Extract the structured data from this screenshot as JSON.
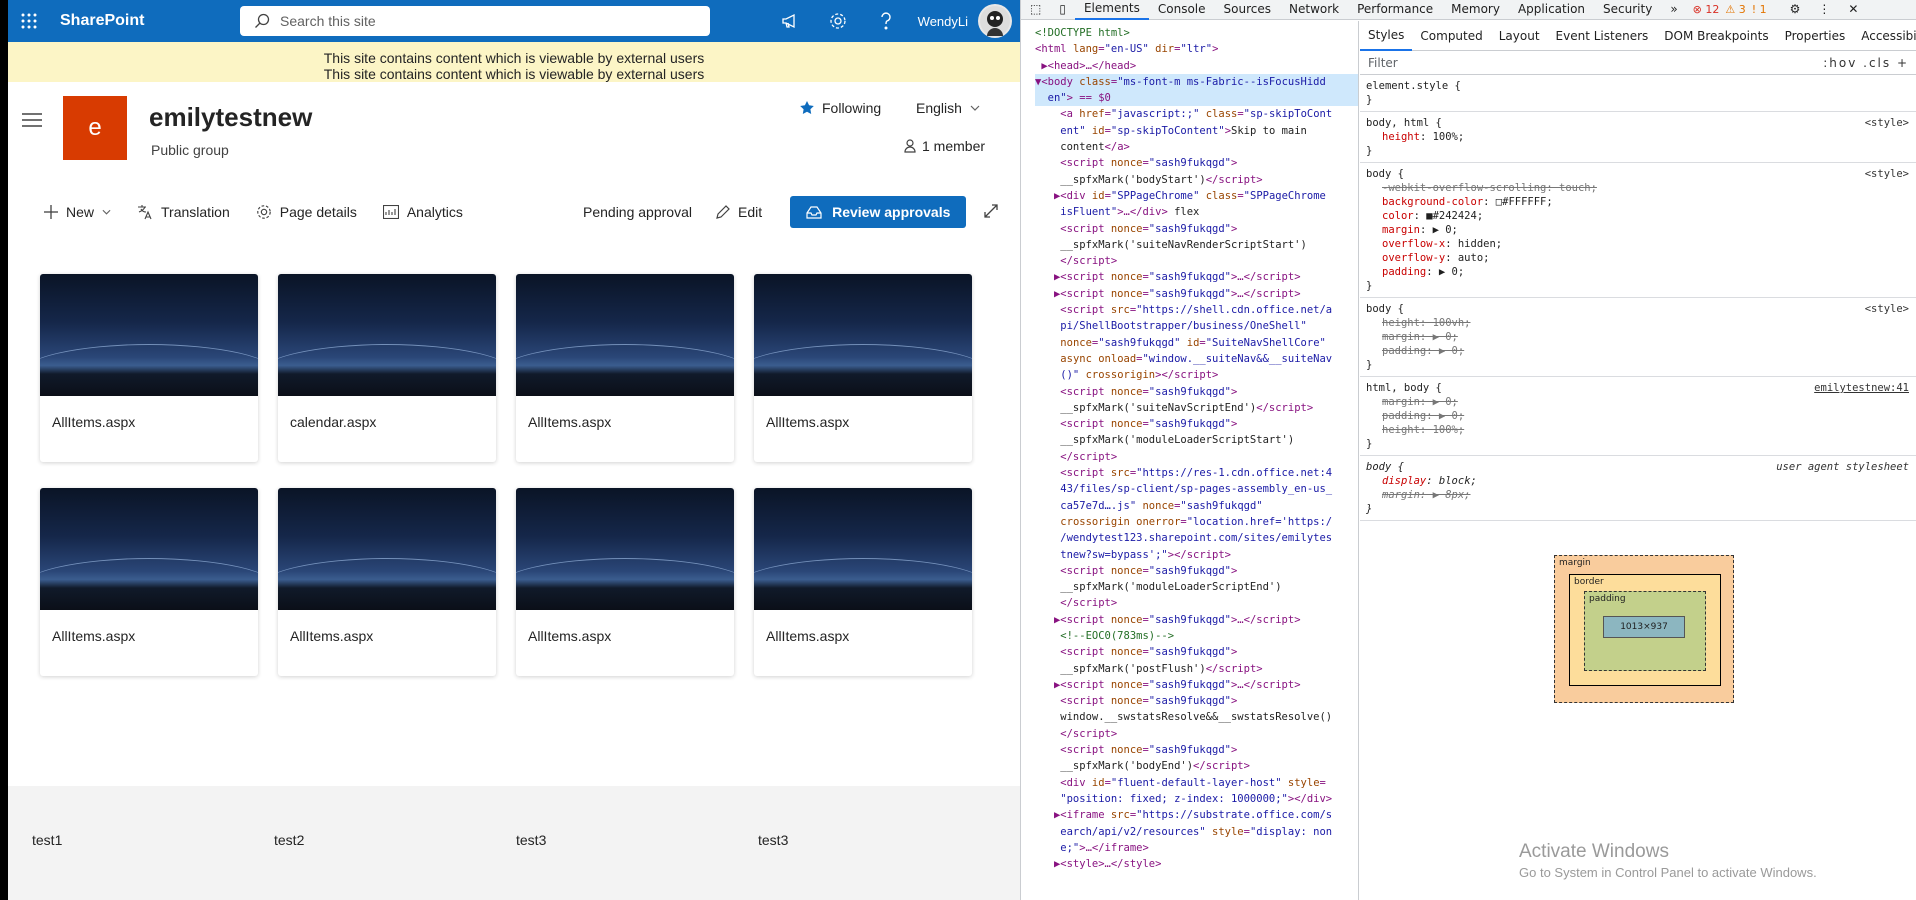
{
  "suite": {
    "brand": "SharePoint",
    "search_placeholder": "Search this site",
    "user": "WendyLi"
  },
  "banner": {
    "line1": "This site contains content which is viewable by external users",
    "line2": "This site contains content which is viewable by external users"
  },
  "site": {
    "logo_letter": "e",
    "title": "emilytestnew",
    "subtitle": "Public group",
    "following": "Following",
    "language": "English",
    "members": "1 member"
  },
  "commands": {
    "new": "New",
    "translation": "Translation",
    "page_details": "Page details",
    "analytics": "Analytics",
    "pending": "Pending approval",
    "edit": "Edit",
    "review": "Review approvals"
  },
  "cards": [
    "AllItems.aspx",
    "calendar.aspx",
    "AllItems.aspx",
    "AllItems.aspx",
    "AllItems.aspx",
    "AllItems.aspx",
    "AllItems.aspx",
    "AllItems.aspx"
  ],
  "footer": [
    "test1",
    "test2",
    "test3",
    "test3"
  ],
  "devtools": {
    "tabs": [
      "Elements",
      "Console",
      "Sources",
      "Network",
      "Performance",
      "Memory",
      "Application",
      "Security"
    ],
    "errors": "12",
    "warnings": "3",
    "issues": "1",
    "style_tabs": [
      "Styles",
      "Computed",
      "Layout",
      "Event Listeners",
      "DOM Breakpoints",
      "Properties",
      "Accessibility"
    ],
    "filter": "Filter",
    "filter_tools": ":hov .cls +",
    "box": {
      "margin": "margin",
      "border": "border",
      "padding": "padding",
      "content": "1013×937",
      "dash": "–"
    },
    "activate1": "Activate Windows",
    "activate2": "Go to System in Control Panel to activate Windows."
  },
  "colors": {
    "suite": "#0f6cbd",
    "logo": "#d83b01",
    "banner": "#fcf5c6"
  }
}
